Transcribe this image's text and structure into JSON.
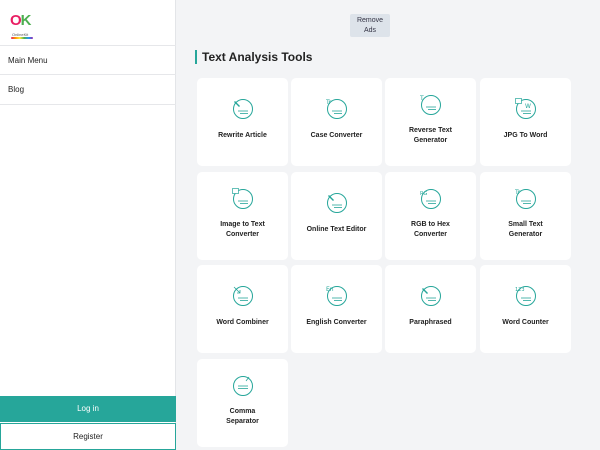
{
  "brand": {
    "logo_main": "OK",
    "logo_sub": "OnlineKit"
  },
  "sidebar": {
    "items": [
      {
        "label": "Main Menu"
      },
      {
        "label": "Blog"
      }
    ],
    "login_label": "Log in",
    "register_label": "Register"
  },
  "header": {
    "remove_ads_line1": "Remove",
    "remove_ads_line2": "Ads"
  },
  "main": {
    "title": "Text Analysis Tools",
    "tools": [
      {
        "line1": "Rewrite Article",
        "line2": "",
        "icon": "pen-icon"
      },
      {
        "line1": "Case Converter",
        "line2": "",
        "icon": "text-case-icon"
      },
      {
        "line1": "Reverse Text",
        "line2": "Generator",
        "icon": "reverse-text-icon"
      },
      {
        "line1": "JPG To Word",
        "line2": "",
        "icon": "image-to-word-icon"
      },
      {
        "line1": "Image to Text",
        "line2": "Converter",
        "icon": "image-to-text-icon"
      },
      {
        "line1": "Online Text Editor",
        "line2": "",
        "icon": "edit-icon"
      },
      {
        "line1": "RGB to Hex",
        "line2": "Converter",
        "icon": "rgb-hex-icon"
      },
      {
        "line1": "Small Text",
        "line2": "Generator",
        "icon": "small-text-icon"
      },
      {
        "line1": "Word Combiner",
        "line2": "",
        "icon": "combine-icon"
      },
      {
        "line1": "English Converter",
        "line2": "",
        "icon": "language-icon"
      },
      {
        "line1": "Paraphrased",
        "line2": "",
        "icon": "paraphrase-icon"
      },
      {
        "line1": "Word Counter",
        "line2": "",
        "icon": "counter-icon"
      },
      {
        "line1": "Comma",
        "line2": "Separator",
        "icon": "comma-icon"
      }
    ],
    "icon_text": {
      "case": "Tr",
      "reverse": "T",
      "small": "Tr",
      "english": "En",
      "counter": "123",
      "rgb": "RG"
    }
  },
  "colors": {
    "accent": "#26a69a",
    "background": "#f3f4f6",
    "card": "#ffffff"
  }
}
